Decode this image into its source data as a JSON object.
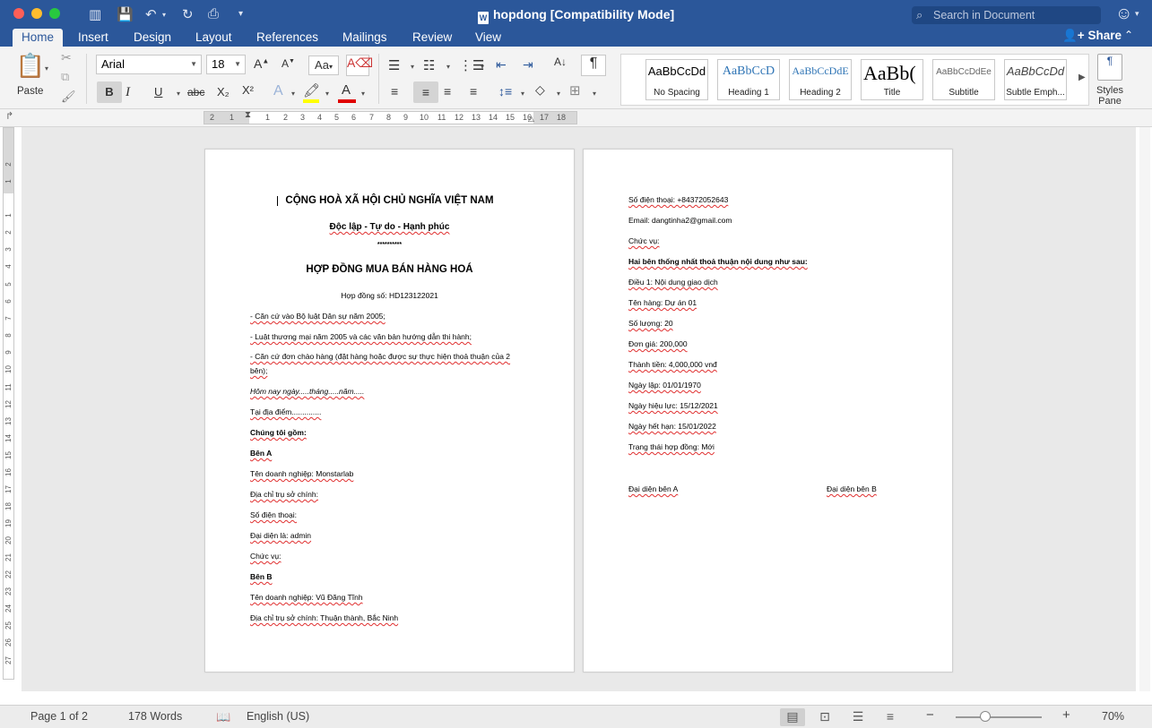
{
  "window": {
    "title": "hopdong [Compatibility Mode]",
    "search_placeholder": "Search in Document"
  },
  "tabs": [
    "Home",
    "Insert",
    "Design",
    "Layout",
    "References",
    "Mailings",
    "Review",
    "View"
  ],
  "share_label": "Share",
  "ribbon": {
    "paste_label": "Paste",
    "font_name": "Arial",
    "font_size": "18",
    "bold": "B",
    "italic": "I",
    "underline": "U",
    "strikethrough": "abc",
    "subscript": "X₂",
    "superscript": "X²",
    "styles_pane_label": "Styles Pane",
    "styles": [
      {
        "sample": "AaBbCcDd",
        "name": "No Spacing"
      },
      {
        "sample": "AaBbCcD",
        "name": "Heading 1"
      },
      {
        "sample": "AaBbCcDdE",
        "name": "Heading 2"
      },
      {
        "sample": "AaBb(",
        "name": "Title"
      },
      {
        "sample": "AaBbCcDdEe",
        "name": "Subtitle"
      },
      {
        "sample": "AaBbCcDd",
        "name": "Subtle Emph..."
      }
    ]
  },
  "ruler": {
    "numbers": [
      "2",
      "1",
      "1",
      "2",
      "3",
      "4",
      "5",
      "6",
      "7",
      "8",
      "9",
      "10",
      "11",
      "12",
      "13",
      "14",
      "15",
      "16",
      "17",
      "18"
    ],
    "vnumbers": [
      "2",
      "1",
      "1",
      "2",
      "3",
      "4",
      "5",
      "6",
      "7",
      "8",
      "9",
      "10",
      "11",
      "12",
      "13",
      "14",
      "15",
      "16",
      "17",
      "18",
      "19",
      "20",
      "21",
      "22",
      "23",
      "24",
      "25",
      "26",
      "27"
    ]
  },
  "page1": {
    "heading1": "CỘNG HOÀ XÃ HỘI CHỦ NGHĨA VIỆT NAM",
    "heading2": "Độc lập - Tự do - Hạnh phúc",
    "stars": "**********",
    "heading3": "HỢP ĐỒNG MUA BÁN HÀNG HOÁ",
    "contract_no": "Hợp đồng số: HD123122021",
    "law1": "- Căn cứ vào Bộ luật Dân sự năm 2005;",
    "law2": "- Luật thương mại năm 2005 và các văn bản hướng dẫn thi hành;",
    "law3a": "- Căn cứ đơn chào hàng (đặt hàng hoặc được sự thực hiện thoả thuận của 2",
    "law3b": "bên);",
    "date_line": "Hôm nay ngày.....tháng.....năm.....",
    "place": "Tại địa điểm..............",
    "we": "Chúng tôi gồm:",
    "party_a": "Bên A",
    "a_company": "Tên doanh nghiệp: Monstarlab",
    "a_address": "Địa chỉ trụ sở chính:",
    "a_phone": "Số điện thoại:",
    "a_rep": "Đại diện là: admin",
    "a_title": "Chức vụ:",
    "party_b": "Bên B",
    "b_company": "Tên doanh nghiệp: Vũ Đăng Tĩnh",
    "b_address": "Địa chỉ trụ sở chính: Thuận thành,  Bắc Ninh"
  },
  "page2": {
    "b_phone": "Số điện thoại: +84372052643",
    "b_email": "Email: dangtinha2@gmail.com",
    "b_title": "Chức vụ:",
    "agreement": "Hai bên thống nhất thoả thuận nội dung như sau:",
    "article1": "Điều 1: Nội dung giao dịch",
    "goods": "Tên hàng: Dự án 01",
    "qty": "Số lượng: 20",
    "price": "Đơn giá: 200,000",
    "total": "Thành tiền: 4,000,000 vnđ",
    "created": "Ngày lập: 01/01/1970",
    "effective": "Ngày hiệu lực: 15/12/2021",
    "expiry": "Ngày hết hạn: 15/01/2022",
    "status": "Trạng thái hợp đồng: Mới",
    "sign_a": "Đại diện bên A",
    "sign_b": "Đại diện bên B"
  },
  "status": {
    "page": "Page 1 of 2",
    "words": "178 Words",
    "language": "English (US)",
    "zoom": "70%"
  },
  "colors": {
    "brand": "#2b579a",
    "highlight": "#ffff00",
    "font_color": "#e00000"
  }
}
